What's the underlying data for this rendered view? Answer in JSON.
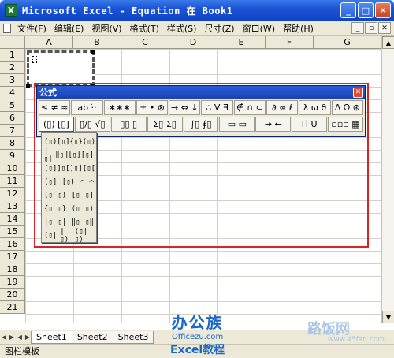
{
  "window": {
    "title": "Microsoft Excel - Equation 在 Book1",
    "app_icon": "X",
    "minimize": "_",
    "maximize": "□",
    "close": "✕"
  },
  "menu": {
    "items": [
      "文件(F)",
      "编辑(E)",
      "视图(V)",
      "格式(T)",
      "样式(S)",
      "尺寸(Z)",
      "窗口(W)",
      "帮助(H)"
    ],
    "ctrls": [
      "_",
      "▫",
      "✕"
    ]
  },
  "columns": [
    "A",
    "B",
    "C",
    "D",
    "E",
    "F",
    "G"
  ],
  "rows": [
    "1",
    "2",
    "3",
    "4",
    "5",
    "6",
    "7",
    "8",
    "9",
    "10",
    "11",
    "12",
    "13",
    "14",
    "15",
    "16",
    "17",
    "18",
    "19",
    "20",
    "21"
  ],
  "palette": {
    "title": "公式",
    "close": "✕",
    "row1": [
      "≤ ≠ ≈",
      "ȧb ·̇·",
      "∗∗∗",
      "± • ⊗",
      "→ ⇔ ↓",
      "∴ ∀ ∃",
      "∉ ∩ ⊂",
      "∂ ∞ ℓ",
      "λ ω θ",
      "Λ Ω ⊛"
    ],
    "row2": [
      "(▯) [▯]",
      "▯/▯ √▯",
      "▯▯ ▯̲",
      "Σ▯ Σ▯",
      "∫▯ ∮▯",
      "▭ ▭",
      "→ ←",
      "Π̇ Ụ̇",
      "▫▫▫ ▦"
    ]
  },
  "dropdown": {
    "rows": [
      [
        "(▯)",
        "[▯]",
        "{▯}",
        "⟨▯⟩"
      ],
      [
        "|▯|",
        "‖▯‖",
        "⌊▯⌋",
        "⌈▯⌉"
      ],
      [
        "[▯]",
        "]▯[",
        "]▯]",
        "[▯["
      ],
      [
        "(▯]",
        "[▯)",
        "⌒",
        "⌒"
      ],
      [
        "(▯",
        "▯)",
        "[▯",
        "▯]"
      ],
      [
        "{▯",
        "▯}",
        "⟨▯",
        "▯⟩"
      ],
      [
        "|▯",
        "▯|",
        "‖▯",
        "▯‖"
      ],
      [
        "⟨▯|",
        "|▯⟩",
        "⟨▯|▯⟩"
      ]
    ]
  },
  "sheets": {
    "nav": [
      "◀",
      "▶"
    ],
    "tabs": [
      "Sheet1",
      "Sheet2",
      "Sheet3"
    ]
  },
  "status": "图栏模板",
  "watermark": {
    "main": "办公族",
    "url": "Officezu.com",
    "sub": "Excel教程",
    "right": "路饭网",
    "right_url": "www.45fan.com"
  }
}
